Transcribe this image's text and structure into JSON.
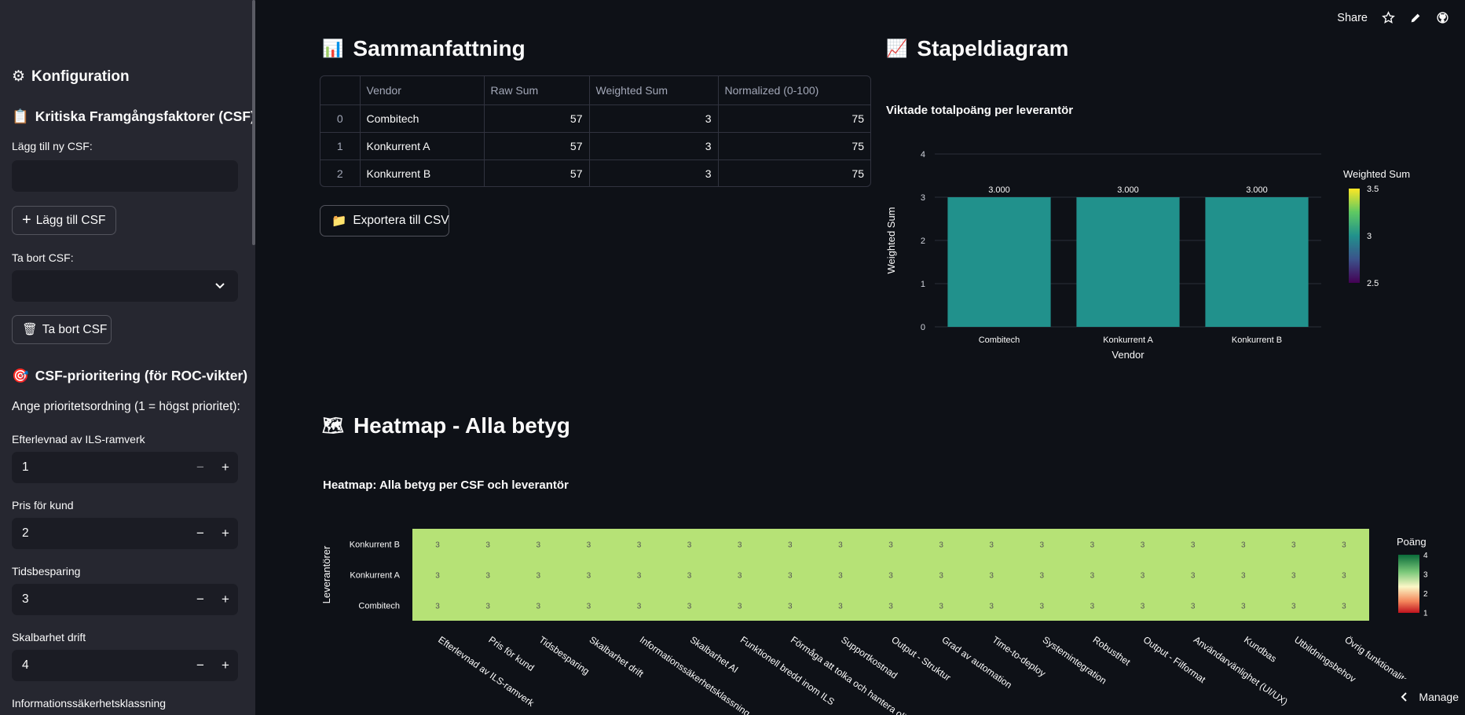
{
  "sidebar": {
    "config_title": "Konfiguration",
    "csf_title": "Kritiska Framgångsfaktorer (CSF)",
    "add_label": "Lägg till ny CSF:",
    "add_value": "",
    "add_button": "Lägg till CSF",
    "remove_label": "Ta bort CSF:",
    "remove_button": "Ta bort CSF",
    "prio_title": "CSF-prioritering (för ROC-vikter)",
    "prio_text": "Ange prioritetsordning (1 = högst prioritet):",
    "priorities": [
      {
        "label": "Efterlevnad av ILS-ramverk",
        "value": "1"
      },
      {
        "label": "Pris för kund",
        "value": "2"
      },
      {
        "label": "Tidsbesparing",
        "value": "3"
      },
      {
        "label": "Skalbarhet drift",
        "value": "4"
      }
    ],
    "next_label": "Informationssäkerhetsklassning"
  },
  "toolbar": {
    "share": "Share"
  },
  "summary": {
    "title": "Sammanfattning",
    "columns": [
      "",
      "Vendor",
      "Raw Sum",
      "Weighted Sum",
      "Normalized (0-100)"
    ],
    "rows": [
      {
        "idx": "0",
        "vendor": "Combitech",
        "raw": "57",
        "weighted": "3",
        "normalized": "75"
      },
      {
        "idx": "1",
        "vendor": "Konkurrent A",
        "raw": "57",
        "weighted": "3",
        "normalized": "75"
      },
      {
        "idx": "2",
        "vendor": "Konkurrent B",
        "raw": "57",
        "weighted": "3",
        "normalized": "75"
      }
    ],
    "export_button": "Exportera till CSV"
  },
  "bar_section": {
    "title": "Stapeldiagram"
  },
  "heat_section": {
    "title": "Heatmap - Alla betyg"
  },
  "chart_data": [
    {
      "type": "bar",
      "title": "Viktade totalpoäng per leverantör",
      "xlabel": "Vendor",
      "ylabel": "Weighted Sum",
      "categories": [
        "Combitech",
        "Konkurrent A",
        "Konkurrent B"
      ],
      "values": [
        3,
        3,
        3
      ],
      "data_labels": [
        "3.000",
        "3.000",
        "3.000"
      ],
      "ylim": [
        0,
        4
      ],
      "yticks": [
        "0",
        "1",
        "2",
        "3",
        "4"
      ],
      "color": "#21918c",
      "colorbar": {
        "title": "Weighted Sum",
        "ticks": [
          "3.5",
          "3",
          "2.5"
        ]
      }
    },
    {
      "type": "heatmap",
      "title": "Heatmap: Alla betyg per CSF och leverantör",
      "ylabel": "Leverantörer",
      "rows": [
        "Konkurrent B",
        "Konkurrent A",
        "Combitech"
      ],
      "columns": [
        "Efterlevnad av ILS-ramverk",
        "Pris för kund",
        "Tidsbesparing",
        "Skalbarhet drift",
        "Informationssäkerhetsklassning",
        "Skalbarhet AI",
        "Funktionell bredd inom ILS",
        "Förmåga att tolka och hantera olika in…",
        "Supportkostnad",
        "Output - Struktur",
        "Grad av automation",
        "Time-to-deploy",
        "Systemintegration",
        "Robusthet",
        "Output - Filformat",
        "Användarvänlighet (UI/UX)",
        "Kundbas",
        "Utbildningsbehov",
        "Övrig funktionalitet"
      ],
      "values": [
        [
          3,
          3,
          3,
          3,
          3,
          3,
          3,
          3,
          3,
          3,
          3,
          3,
          3,
          3,
          3,
          3,
          3,
          3,
          3
        ],
        [
          3,
          3,
          3,
          3,
          3,
          3,
          3,
          3,
          3,
          3,
          3,
          3,
          3,
          3,
          3,
          3,
          3,
          3,
          3
        ],
        [
          3,
          3,
          3,
          3,
          3,
          3,
          3,
          3,
          3,
          3,
          3,
          3,
          3,
          3,
          3,
          3,
          3,
          3,
          3
        ]
      ],
      "cell_color": "#b6e276",
      "colorbar": {
        "title": "Poäng",
        "ticks": [
          "4",
          "3",
          "2",
          "1"
        ]
      }
    }
  ],
  "manage": {
    "label": "Manage"
  }
}
